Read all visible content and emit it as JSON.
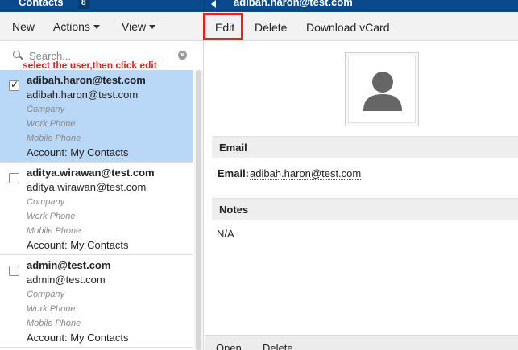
{
  "header": {
    "title": "Contacts",
    "count": "8",
    "selected_user": "adibah.haron@test.com"
  },
  "left_toolbar": {
    "new": "New",
    "actions": "Actions",
    "view": "View"
  },
  "search": {
    "placeholder": "Search...",
    "value": ""
  },
  "annotation": {
    "hint": "select the user,then click edit",
    "color": "#e0231c"
  },
  "contacts": [
    {
      "name": "adibah.haron@test.com",
      "email": "adibah.haron@test.com",
      "company": "Company",
      "work_phone": "Work Phone",
      "mobile_phone": "Mobile Phone",
      "account": "Account: My Contacts",
      "selected": true
    },
    {
      "name": "aditya.wirawan@test.com",
      "email": "aditya.wirawan@test.com",
      "company": "Company",
      "work_phone": "Work Phone",
      "mobile_phone": "Mobile Phone",
      "account": "Account: My Contacts",
      "selected": false
    },
    {
      "name": "admin@test.com",
      "email": "admin@test.com",
      "company": "Company",
      "work_phone": "Work Phone",
      "mobile_phone": "Mobile Phone",
      "account": "Account: My Contacts",
      "selected": false
    }
  ],
  "right_toolbar": {
    "edit": "Edit",
    "delete": "Delete",
    "download": "Download vCard"
  },
  "details": {
    "email_section": "Email",
    "email_label": "Email:",
    "email_value": "adibah.haron@test.com",
    "notes_section": "Notes",
    "notes_value": "N/A"
  },
  "bottom_bar": {
    "open": "Open",
    "delete": "Delete"
  },
  "colors": {
    "header": "#0a4a8c",
    "selected_row": "#b9d7f7",
    "highlight": "#e0231c"
  }
}
